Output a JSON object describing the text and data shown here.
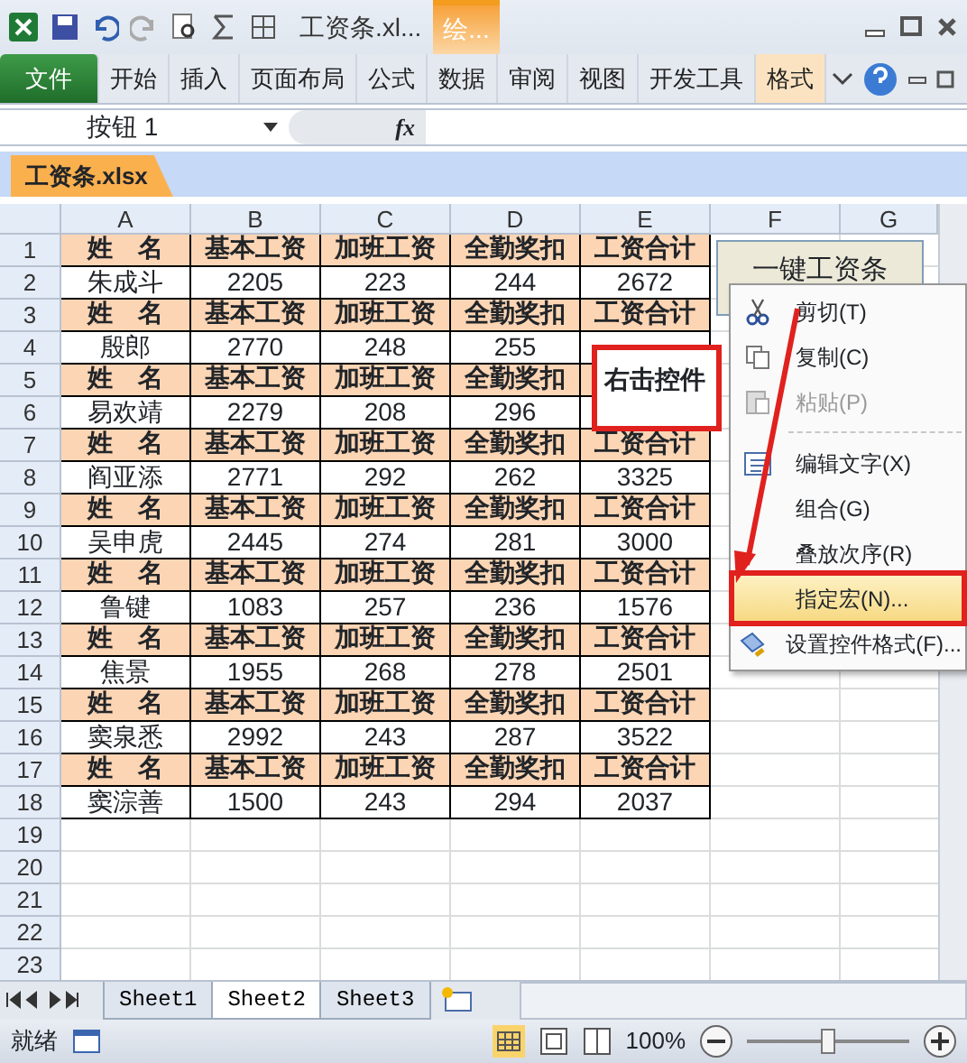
{
  "title_bar": {
    "title": "工资条.xl...",
    "context_tab": "绘..."
  },
  "ribbon_tabs": [
    {
      "label": "文件",
      "kind": "file",
      "selected": false
    },
    {
      "label": "开始",
      "kind": "tab",
      "selected": false
    },
    {
      "label": "插入",
      "kind": "tab",
      "selected": false
    },
    {
      "label": "页面布局",
      "kind": "tab",
      "selected": false
    },
    {
      "label": "公式",
      "kind": "tab",
      "selected": false
    },
    {
      "label": "数据",
      "kind": "tab",
      "selected": false
    },
    {
      "label": "审阅",
      "kind": "tab",
      "selected": false
    },
    {
      "label": "视图",
      "kind": "tab",
      "selected": false
    },
    {
      "label": "开发工具",
      "kind": "tab",
      "selected": false
    },
    {
      "label": "格式",
      "kind": "context",
      "selected": true
    }
  ],
  "formula_bar": {
    "name_box": "按钮 1",
    "fx": "fx"
  },
  "workbook_tab": "工资条.xlsx",
  "columns": [
    "A",
    "B",
    "C",
    "D",
    "E",
    "F",
    "G"
  ],
  "row_numbers": [
    "1",
    "2",
    "3",
    "4",
    "5",
    "6",
    "7",
    "8",
    "9",
    "10",
    "11",
    "12",
    "13",
    "14",
    "15",
    "16",
    "17",
    "18",
    "19",
    "20",
    "21",
    "22",
    "23"
  ],
  "rows": [
    {
      "kind": "header",
      "cells": [
        "姓　名",
        "基本工资",
        "加班工资",
        "全勤奖扣",
        "工资合计"
      ]
    },
    {
      "kind": "data",
      "cells": [
        "朱成斗",
        "2205",
        "223",
        "244",
        "2672"
      ]
    },
    {
      "kind": "header",
      "cells": [
        "姓　名",
        "基本工资",
        "加班工资",
        "全勤奖扣",
        "工资合计"
      ]
    },
    {
      "kind": "data",
      "cells": [
        "殷郎",
        "2770",
        "248",
        "255",
        null
      ]
    },
    {
      "kind": "header",
      "cells": [
        "姓　名",
        "基本工资",
        "加班工资",
        "全勤奖扣",
        null
      ]
    },
    {
      "kind": "data",
      "cells": [
        "易欢靖",
        "2279",
        "208",
        "296",
        null
      ]
    },
    {
      "kind": "header",
      "cells": [
        "姓　名",
        "基本工资",
        "加班工资",
        "全勤奖扣",
        "工资合计"
      ]
    },
    {
      "kind": "data",
      "cells": [
        "阎亚添",
        "2771",
        "292",
        "262",
        "3325"
      ]
    },
    {
      "kind": "header",
      "cells": [
        "姓　名",
        "基本工资",
        "加班工资",
        "全勤奖扣",
        "工资合计"
      ]
    },
    {
      "kind": "data",
      "cells": [
        "吴申虎",
        "2445",
        "274",
        "281",
        "3000"
      ]
    },
    {
      "kind": "header",
      "cells": [
        "姓　名",
        "基本工资",
        "加班工资",
        "全勤奖扣",
        "工资合计"
      ]
    },
    {
      "kind": "data",
      "cells": [
        "鲁键",
        "1083",
        "257",
        "236",
        "1576"
      ]
    },
    {
      "kind": "header",
      "cells": [
        "姓　名",
        "基本工资",
        "加班工资",
        "全勤奖扣",
        "工资合计"
      ]
    },
    {
      "kind": "data",
      "cells": [
        "焦景",
        "1955",
        "268",
        "278",
        "2501"
      ]
    },
    {
      "kind": "header",
      "cells": [
        "姓　名",
        "基本工资",
        "加班工资",
        "全勤奖扣",
        "工资合计"
      ]
    },
    {
      "kind": "data",
      "cells": [
        "窦泉悉",
        "2992",
        "243",
        "287",
        "3522"
      ]
    },
    {
      "kind": "header",
      "cells": [
        "姓　名",
        "基本工资",
        "加班工资",
        "全勤奖扣",
        "工资合计"
      ]
    },
    {
      "kind": "data",
      "cells": [
        "窦淙善",
        "1500",
        "243",
        "294",
        "2037"
      ]
    }
  ],
  "form_button": {
    "label": "一键工资条"
  },
  "callout": {
    "text": "右击控件"
  },
  "context_menu": [
    {
      "kind": "item",
      "label": "剪切(T)",
      "disabled": false,
      "selected": false
    },
    {
      "kind": "item",
      "label": "复制(C)",
      "disabled": false,
      "selected": false
    },
    {
      "kind": "item",
      "label": "粘贴(P)",
      "disabled": true,
      "selected": false
    },
    {
      "kind": "separator"
    },
    {
      "kind": "item",
      "label": "编辑文字(X)",
      "disabled": false,
      "selected": false
    },
    {
      "kind": "item",
      "label": "组合(G)",
      "disabled": false,
      "selected": false
    },
    {
      "kind": "item",
      "label": "叠放次序(R)",
      "disabled": false,
      "selected": false
    },
    {
      "kind": "item",
      "label": "指定宏(N)...",
      "disabled": false,
      "selected": true
    },
    {
      "kind": "item",
      "label": "设置控件格式(F)...",
      "disabled": false,
      "selected": false
    }
  ],
  "sheet_tabs": [
    {
      "label": "Sheet1",
      "selected": false
    },
    {
      "label": "Sheet2",
      "selected": true
    },
    {
      "label": "Sheet3",
      "selected": false
    }
  ],
  "status_bar": {
    "status": "就绪",
    "zoom": "100%",
    "zoom_slider": {
      "level": 0.5
    }
  }
}
